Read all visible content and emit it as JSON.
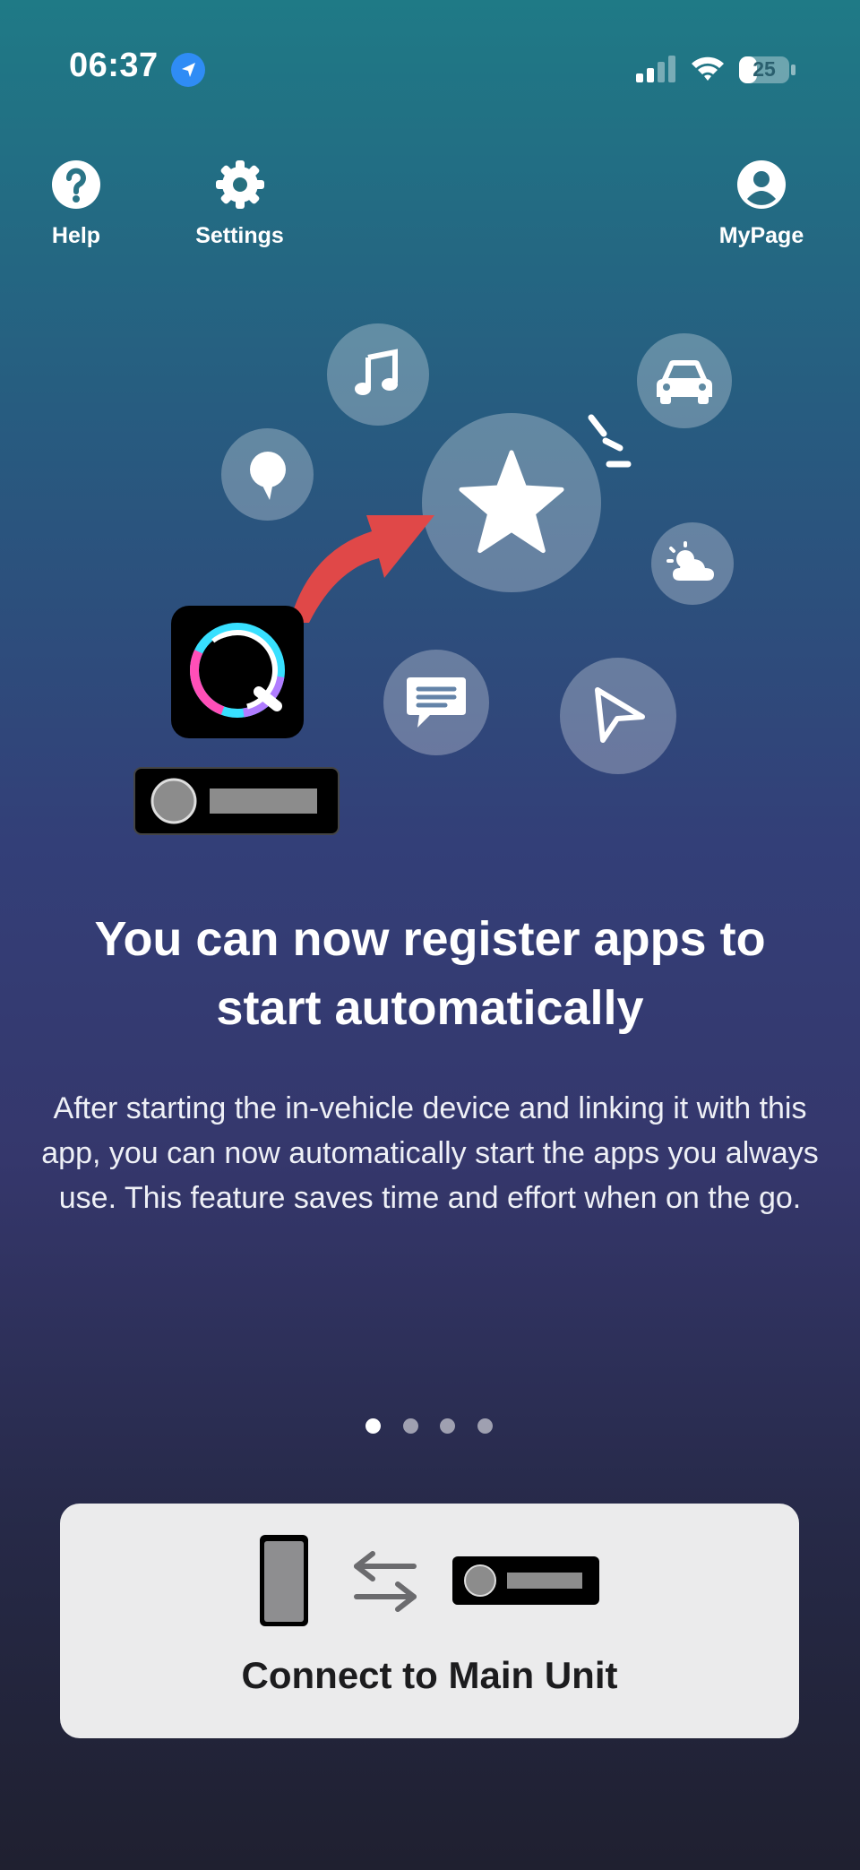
{
  "status_bar": {
    "time": "06:37",
    "battery": "25"
  },
  "nav": {
    "help_label": "Help",
    "settings_label": "Settings",
    "mypage_label": "MyPage"
  },
  "illustration": {
    "icons": [
      "music-icon",
      "car-icon",
      "map-pin-icon",
      "star-icon",
      "weather-icon",
      "message-icon",
      "navigation-icon",
      "app-logo-icon",
      "head-unit-icon"
    ]
  },
  "onboarding": {
    "title_line1": "You can now register apps to",
    "title_line2": "start automatically",
    "description": "After starting the in-vehicle device and linking it with this app, you can now automatically start the apps you always use. This feature saves time and effort when on the go.",
    "page_count": 4,
    "current_page": 1
  },
  "connect_button": {
    "label": "Connect to Main Unit"
  },
  "colors": {
    "accent_red": "#e04848",
    "location_blue": "#2f8cf5",
    "button_bg": "#ebebec"
  }
}
